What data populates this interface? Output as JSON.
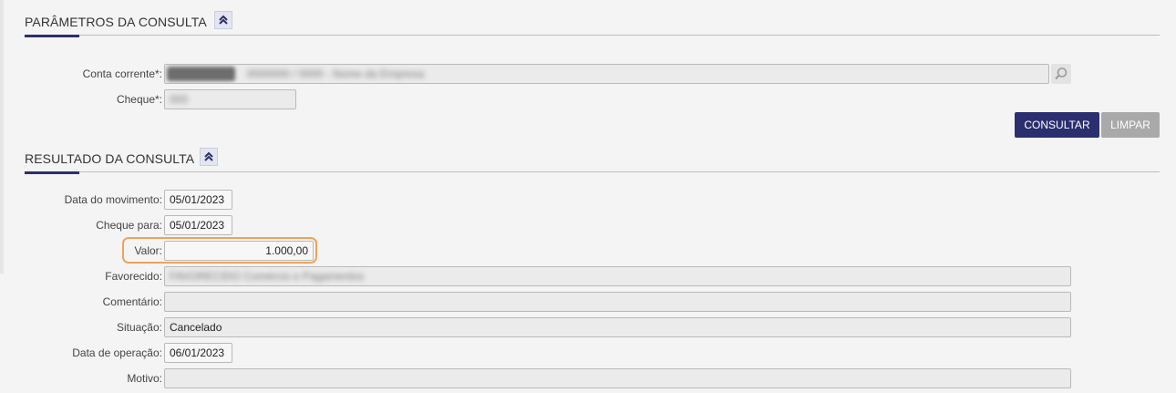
{
  "params": {
    "title": "PARÂMETROS DA CONSULTA",
    "conta_corrente_label": "Conta corrente*:",
    "conta_corrente_value": "0000000 / 0000 - Nome da Empresa",
    "cheque_label": "Cheque*:",
    "cheque_value": "000"
  },
  "buttons": {
    "consultar": "CONSULTAR",
    "limpar": "LIMPAR"
  },
  "result": {
    "title": "RESULTADO DA CONSULTA",
    "data_movimento_label": "Data do movimento:",
    "data_movimento_value": "05/01/2023",
    "cheque_para_label": "Cheque para:",
    "cheque_para_value": "05/01/2023",
    "valor_label": "Valor:",
    "valor_value": "1.000,00",
    "favorecido_label": "Favorecido:",
    "favorecido_value": "FAVORECIDO Comércio e Pagamentos",
    "comentario_label": "Comentário:",
    "comentario_value": "",
    "situacao_label": "Situação:",
    "situacao_value": "Cancelado",
    "data_operacao_label": "Data de operação:",
    "data_operacao_value": "06/01/2023",
    "motivo_label": "Motivo:",
    "motivo_value": ""
  },
  "colors": {
    "primary": "#2b2f6f",
    "disabled": "#a9a9a9",
    "highlight": "#f0a35a"
  }
}
